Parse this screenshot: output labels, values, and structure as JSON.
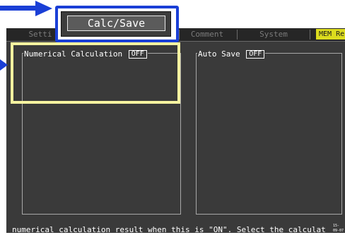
{
  "tabs": [
    {
      "label": "Setti",
      "state": "inactive"
    },
    {
      "label": "Comment",
      "state": "inactive"
    },
    {
      "label": "System",
      "state": "inactive"
    },
    {
      "label": "MEM Re",
      "state": "active"
    }
  ],
  "calc_save_button": {
    "label": "Calc/Save"
  },
  "panels": {
    "numerical_calculation": {
      "label": "Numerical Calculation",
      "value": "OFF"
    },
    "auto_save": {
      "label": "Auto Save",
      "value": "OFF"
    }
  },
  "status_bar": {
    "message": "numerical calculation result when this is \"ON\". Select the calculat",
    "clock": "15-09-07"
  },
  "colors": {
    "annotation_arrow": "#1a3fd6",
    "annotation_box_blue": "#1a3fd6",
    "annotation_box_yellow": "#f7f3a0",
    "screen_background": "#3a3a3a",
    "active_tab": "#dcdc1e"
  }
}
